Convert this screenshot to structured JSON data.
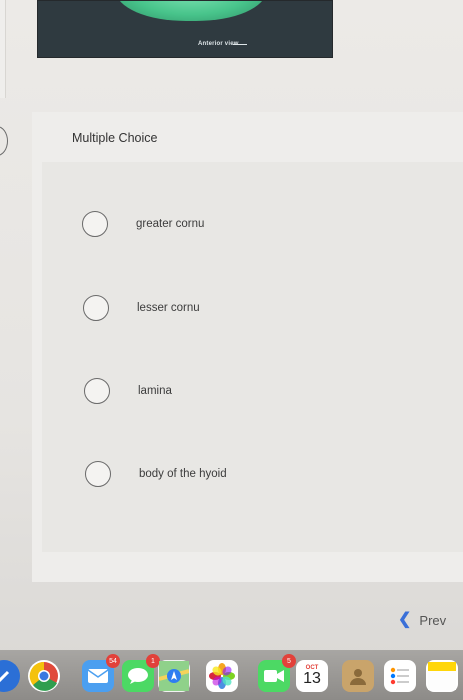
{
  "figure": {
    "caption": "Anterior view"
  },
  "question": {
    "type_label": "Multiple Choice",
    "options": [
      {
        "label": "greater cornu"
      },
      {
        "label": "lesser cornu"
      },
      {
        "label": "lamina"
      },
      {
        "label": "body of the hyoid"
      }
    ]
  },
  "navigation": {
    "prev_label": "Prev"
  },
  "dock": {
    "mail_badge": "54",
    "messages_badge": "1",
    "facetime_badge": "5",
    "calendar_month": "OCT",
    "calendar_day": "13"
  },
  "colors": {
    "accent": "#3a6fd8",
    "badge": "#e2413a"
  }
}
